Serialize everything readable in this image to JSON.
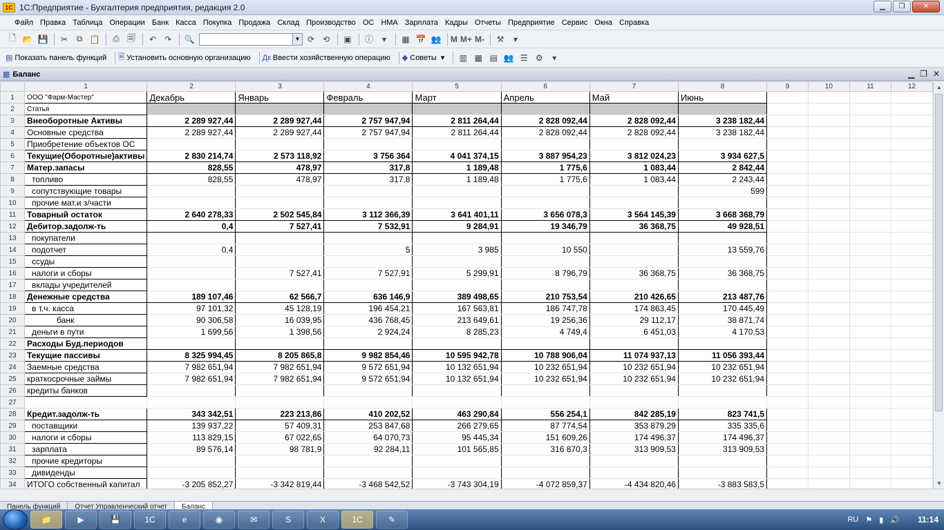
{
  "window": {
    "title": "1С:Предприятие - Бухгалтерия предприятия, редакция 2.0",
    "logo": "1С"
  },
  "menu": [
    "Файл",
    "Правка",
    "Таблица",
    "Операции",
    "Банк",
    "Касса",
    "Покупка",
    "Продажа",
    "Склад",
    "Производство",
    "ОС",
    "НМА",
    "Зарплата",
    "Кадры",
    "Отчеты",
    "Предприятие",
    "Сервис",
    "Окна",
    "Справка"
  ],
  "toolbar2": {
    "show_panel": "Показать панель функций",
    "set_org": "Установить основную организацию",
    "enter_op": "Ввести хозяйственную операцию",
    "tips": "Советы"
  },
  "toolbar1_labels": {
    "m": "M",
    "m_plus": "M+",
    "m_minus": "M-"
  },
  "document": {
    "title": "Баланс"
  },
  "sheet": {
    "col_headers": [
      "1",
      "2",
      "3",
      "4",
      "5",
      "6",
      "7",
      "8",
      "9",
      "10",
      "11",
      "12"
    ],
    "org": "ООО \"Фарм-Мастер\"",
    "months": [
      "Декабрь",
      "Январь",
      "Февраль",
      "Март",
      "Апрель",
      "Май",
      "Июнь"
    ],
    "rows": [
      {
        "n": "2",
        "label": "Статья",
        "vals": [
          "",
          "",
          "",
          "",
          "",
          "",
          ""
        ],
        "style": "gray"
      },
      {
        "n": "3",
        "label": "Внеоборотные Активы",
        "vals": [
          "2 289 927,44",
          "2 289 927,44",
          "2 757 947,94",
          "2 811 264,44",
          "2 828 092,44",
          "2 828 092,44",
          "3 238 182,44"
        ],
        "style": "b"
      },
      {
        "n": "4",
        "label": "Основные средства",
        "vals": [
          "2 289 927,44",
          "2 289 927,44",
          "2 757 947,94",
          "2 811 264,44",
          "2 828 092,44",
          "2 828 092,44",
          "3 238 182,44"
        ],
        "style": ""
      },
      {
        "n": "5",
        "label": "Приобретение объектов ОС",
        "vals": [
          "",
          "",
          "",
          "",
          "",
          "",
          ""
        ],
        "style": ""
      },
      {
        "n": "6",
        "label": "Текущие(Оборотные)активы",
        "vals": [
          "2 830 214,74",
          "2 573 118,92",
          "3 756 364",
          "4 041 374,15",
          "3 887 954,23",
          "3 812 024,23",
          "3 934 627,5"
        ],
        "style": "b"
      },
      {
        "n": "7",
        "label": "Матер.запасы",
        "vals": [
          "828,55",
          "478,97",
          "317,8",
          "1 189,48",
          "1 775,6",
          "1 083,44",
          "2 842,44"
        ],
        "style": "b"
      },
      {
        "n": "8",
        "label": "топливо",
        "vals": [
          "828,55",
          "478,97",
          "317,8",
          "1 189,48",
          "1 775,6",
          "1 083,44",
          "2 243,44"
        ],
        "style": "ind"
      },
      {
        "n": "9",
        "label": "сопутствующие товары",
        "vals": [
          "",
          "",
          "",
          "",
          "",
          "",
          "599"
        ],
        "style": "ind"
      },
      {
        "n": "10",
        "label": "прочие мат.и з/части",
        "vals": [
          "",
          "",
          "",
          "",
          "",
          "",
          ""
        ],
        "style": "ind"
      },
      {
        "n": "11",
        "label": "Товарный остаток",
        "vals": [
          "2 640 278,33",
          "2 502 545,84",
          "3 112 366,39",
          "3 641 401,11",
          "3 656 078,3",
          "3 564 145,39",
          "3 668 368,79"
        ],
        "style": "b"
      },
      {
        "n": "12",
        "label": "Дебитор.задолж-ть",
        "vals": [
          "0,4",
          "7 527,41",
          "7 532,91",
          "9 284,91",
          "19 346,79",
          "36 368,75",
          "49 928,51"
        ],
        "style": "b"
      },
      {
        "n": "13",
        "label": "покупатели",
        "vals": [
          "",
          "",
          "",
          "",
          "",
          "",
          ""
        ],
        "style": "ind"
      },
      {
        "n": "14",
        "label": "подотчет",
        "vals": [
          "0,4",
          "",
          "5",
          "3 985",
          "10 550",
          "",
          "13 559,76"
        ],
        "style": "ind"
      },
      {
        "n": "15",
        "label": "ссуды",
        "vals": [
          "",
          "",
          "",
          "",
          "",
          "",
          ""
        ],
        "style": "ind"
      },
      {
        "n": "16",
        "label": "налоги и сборы",
        "vals": [
          "",
          "7 527,41",
          "7 527,91",
          "5 299,91",
          "8 796,79",
          "36 368,75",
          "36 368,75"
        ],
        "style": "ind"
      },
      {
        "n": "17",
        "label": "вклады учредителей",
        "vals": [
          "",
          "",
          "",
          "",
          "",
          "",
          ""
        ],
        "style": "ind"
      },
      {
        "n": "18",
        "label": "Денежные средства",
        "vals": [
          "189 107,46",
          "62 566,7",
          "636 146,9",
          "389 498,65",
          "210 753,54",
          "210 426,65",
          "213 487,76"
        ],
        "style": "b"
      },
      {
        "n": "19",
        "label": "в т.ч. касса",
        "vals": [
          "97 101,32",
          "45 128,19",
          "196 454,21",
          "167 563,81",
          "186 747,78",
          "174 863,45",
          "170 445,49"
        ],
        "style": "ind"
      },
      {
        "n": "20",
        "label": "банк",
        "vals": [
          "90 306,58",
          "16 039,95",
          "436 768,45",
          "213 649,61",
          "19 256,36",
          "29 112,17",
          "38 871,74"
        ],
        "style": "ind2"
      },
      {
        "n": "21",
        "label": "деньги в пути",
        "vals": [
          "1 699,56",
          "1 398,56",
          "2 924,24",
          "8 285,23",
          "4 749,4",
          "6 451,03",
          "4 170,53"
        ],
        "style": "ind"
      },
      {
        "n": "22",
        "label": "Расходы Буд.периодов",
        "vals": [
          "",
          "",
          "",
          "",
          "",
          "",
          ""
        ],
        "style": "b"
      },
      {
        "n": "23",
        "label": "Текущие пассивы",
        "vals": [
          "8 325 994,45",
          "8 205 865,8",
          "9 982 854,46",
          "10 595 942,78",
          "10 788 906,04",
          "11 074 937,13",
          "11 056 393,44"
        ],
        "style": "b"
      },
      {
        "n": "24",
        "label": "Заемные средства",
        "vals": [
          "7 982 651,94",
          "7 982 651,94",
          "9 572 651,94",
          "10 132 651,94",
          "10 232 651,94",
          "10 232 651,94",
          "10 232 651,94"
        ],
        "style": ""
      },
      {
        "n": "25",
        "label": "краткосрочные займы",
        "vals": [
          "7 982 651,94",
          "7 982 651,94",
          "9 572 651,94",
          "10 132 651,94",
          "10 232 651,94",
          "10 232 651,94",
          "10 232 651,94"
        ],
        "style": ""
      },
      {
        "n": "26",
        "label": "кредиты банков",
        "vals": [
          "",
          "",
          "",
          "",
          "",
          "",
          ""
        ],
        "style": ""
      },
      {
        "n": "27",
        "label": "",
        "vals": [
          "",
          "",
          "",
          "",
          "",
          "",
          ""
        ],
        "style": "empty"
      },
      {
        "n": "28",
        "label": "Кредит.задолж-ть",
        "vals": [
          "343 342,51",
          "223 213,86",
          "410 202,52",
          "463 290,84",
          "556 254,1",
          "842 285,19",
          "823 741,5"
        ],
        "style": "b"
      },
      {
        "n": "29",
        "label": "поставщики",
        "vals": [
          "139 937,22",
          "57 409,31",
          "253 847,68",
          "266 279,65",
          "87 774,54",
          "353 879,29",
          "335 335,6"
        ],
        "style": "ind"
      },
      {
        "n": "30",
        "label": "налоги и сборы",
        "vals": [
          "113 829,15",
          "67 022,65",
          "64 070,73",
          "95 445,34",
          "151 609,26",
          "174 496,37",
          "174 496,37"
        ],
        "style": "ind"
      },
      {
        "n": "31",
        "label": "зарплата",
        "vals": [
          "89 576,14",
          "98 781,9",
          "92 284,11",
          "101 565,85",
          "316 870,3",
          "313 909,53",
          "313 909,53"
        ],
        "style": "ind"
      },
      {
        "n": "32",
        "label": "прочие кредиторы",
        "vals": [
          "",
          "",
          "",
          "",
          "",
          "",
          ""
        ],
        "style": "ind"
      },
      {
        "n": "33",
        "label": "дивиденды",
        "vals": [
          "",
          "",
          "",
          "",
          "",
          "",
          ""
        ],
        "style": "ind"
      },
      {
        "n": "34",
        "label": "ИТОГО собственный капитал",
        "vals": [
          "-3 205 852,27",
          "-3 342 819,44",
          "-3 468 542,52",
          "-3 743 304,19",
          "-4 072 859,37",
          "-4 434 820,46",
          "-3 883 583,5"
        ],
        "style": ""
      }
    ]
  },
  "tabs": [
    "Панель функций",
    "Отчет  Управленческий отчет",
    "Баланс"
  ],
  "taskbar": {
    "lang": "RU",
    "time": "11:14"
  }
}
